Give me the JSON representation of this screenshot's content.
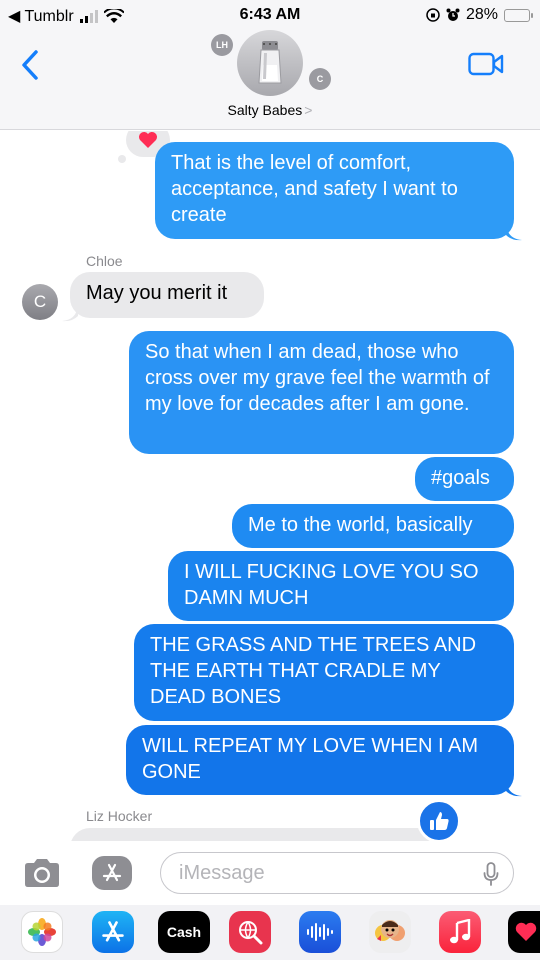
{
  "status_bar": {
    "back_app": "◀ Tumblr",
    "time": "6:43 AM",
    "battery_percent": "28%",
    "battery_level": 0.28,
    "battery_color": "#f5c400"
  },
  "header": {
    "group_name": "Salty Babes",
    "group_chevron": ">",
    "avatar_left_initials": "LH",
    "avatar_right_initials": "C",
    "back_icon": "chevron-left-icon",
    "video_icon": "video-camera-icon",
    "accent_color": "#147efb"
  },
  "messages": [
    {
      "from": "me",
      "text": "That is the level of comfort, acceptance, and safety I want to create",
      "reaction": "heart"
    },
    {
      "from": "Chloe",
      "sender_label": "Chloe",
      "avatar_initial": "C",
      "text": "May you merit it"
    },
    {
      "from": "me",
      "text": "So that when I am dead, those who cross over my grave feel the warmth of my love for decades after I am gone."
    },
    {
      "from": "me",
      "text": "#goals"
    },
    {
      "from": "me",
      "text": "Me to the world, basically"
    },
    {
      "from": "me",
      "text": "I WILL FUCKING LOVE YOU SO DAMN MUCH"
    },
    {
      "from": "me",
      "text": "THE GRASS AND THE TREES AND THE EARTH THAT CRADLE MY DEAD BONES"
    },
    {
      "from": "me",
      "text": "WILL REPEAT MY LOVE WHEN I AM GONE"
    },
    {
      "from": "Liz Hocker",
      "sender_label": "Liz Hocker",
      "text": "",
      "reaction": "thumbs-up"
    }
  ],
  "input": {
    "placeholder": "iMessage",
    "camera_icon": "camera-icon",
    "apps_icon": "app-store-icon",
    "mic_icon": "microphone-icon"
  },
  "app_drawer": [
    {
      "name": "Photos",
      "icon": "photos-icon"
    },
    {
      "name": "App Store",
      "icon": "app-store-icon"
    },
    {
      "name": "Cash",
      "label": "Cash",
      "icon": "apple-cash-icon"
    },
    {
      "name": "Search",
      "icon": "web-search-icon"
    },
    {
      "name": "Audio",
      "icon": "audio-message-icon"
    },
    {
      "name": "Memoji",
      "icon": "memoji-icon"
    },
    {
      "name": "Music",
      "icon": "music-icon"
    },
    {
      "name": "Heart",
      "icon": "digital-touch-icon"
    }
  ]
}
